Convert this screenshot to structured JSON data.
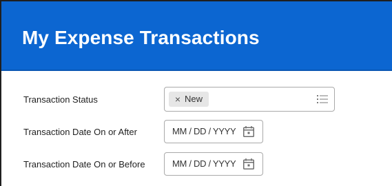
{
  "header": {
    "title": "My Expense Transactions",
    "background_color": "#0c66d1"
  },
  "fields": {
    "status": {
      "label": "Transaction Status",
      "selected_pill": "New",
      "remove_icon": "close-icon",
      "options_icon": "list-icon"
    },
    "date_after": {
      "label": "Transaction Date On or After",
      "placeholder": "MM / DD / YYYY",
      "icon": "calendar-icon"
    },
    "date_before": {
      "label": "Transaction Date On or Before",
      "placeholder": "MM / DD / YYYY",
      "icon": "calendar-icon"
    }
  }
}
